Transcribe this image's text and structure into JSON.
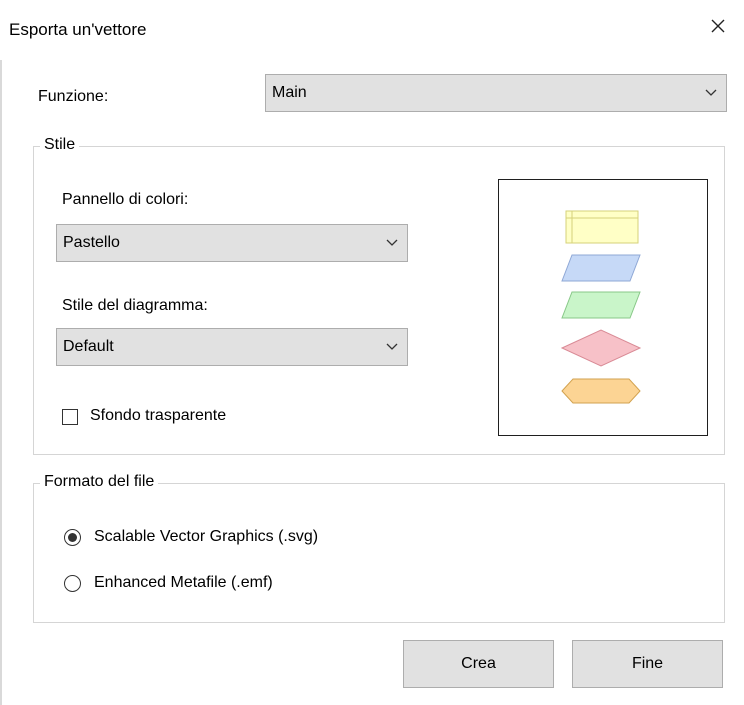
{
  "window": {
    "title": "Esporta un'vettore",
    "close_icon": "close-icon"
  },
  "function": {
    "label": "Funzione:",
    "value": "Main"
  },
  "style_group": {
    "legend": "Stile",
    "palette_label": "Pannello di colori:",
    "palette_value": "Pastello",
    "diagram_style_label": "Stile del diagramma:",
    "diagram_style_value": "Default",
    "transparent_label": "Sfondo trasparente",
    "transparent_checked": false,
    "preview_colors": {
      "yellow": "#ffffc6",
      "blue": "#c6d9f7",
      "green": "#c9f5c9",
      "pink": "#f7c1c8",
      "orange": "#fcd494"
    }
  },
  "format_group": {
    "legend": "Formato del file",
    "options": [
      {
        "label": "Scalable Vector Graphics (.svg)",
        "selected": true
      },
      {
        "label": "Enhanced Metafile (.emf)",
        "selected": false
      }
    ]
  },
  "buttons": {
    "create": "Crea",
    "finish": "Fine"
  }
}
